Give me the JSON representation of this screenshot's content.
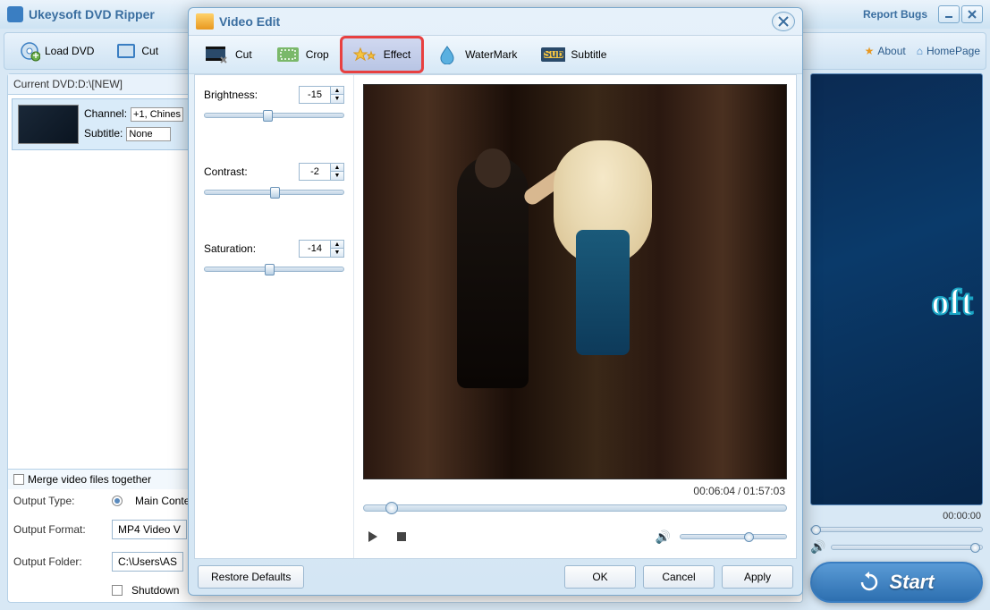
{
  "main": {
    "title": "Ukeysoft DVD Ripper",
    "report_bugs": "Report Bugs",
    "toolbar": {
      "load_dvd": "Load DVD",
      "cut": "Cut",
      "about": "About",
      "homepage": "HomePage"
    },
    "dvd": {
      "current_label": "Current DVD:D:\\[NEW]",
      "channel_label": "Channel:",
      "channel_value": "+1, Chines",
      "subtitle_label": "Subtitle:",
      "subtitle_value": "None"
    },
    "merge_label": "Merge video files together",
    "output_type_label": "Output Type:",
    "output_type_value": "Main Conte",
    "output_format_label": "Output Format:",
    "output_format_value": "MP4 Video V",
    "output_folder_label": "Output Folder:",
    "output_folder_value": "C:\\Users\\AS",
    "shutdown_label": "Shutdown",
    "preview_time": "00:00:00",
    "start": "Start",
    "brand_fragment": "oft"
  },
  "dialog": {
    "title": "Video Edit",
    "tabs": {
      "cut": "Cut",
      "crop": "Crop",
      "effect": "Effect",
      "watermark": "WaterMark",
      "subtitle": "Subtitle"
    },
    "effects": {
      "brightness": {
        "label": "Brightness:",
        "value": "-15",
        "pct": 42
      },
      "contrast": {
        "label": "Contrast:",
        "value": "-2",
        "pct": 47
      },
      "saturation": {
        "label": "Saturation:",
        "value": "-14",
        "pct": 43
      }
    },
    "playback": {
      "position": "00:06:04",
      "duration": "01:57:03",
      "progress_pct": 5,
      "volume_pct": 60
    },
    "buttons": {
      "restore": "Restore Defaults",
      "ok": "OK",
      "cancel": "Cancel",
      "apply": "Apply"
    }
  }
}
